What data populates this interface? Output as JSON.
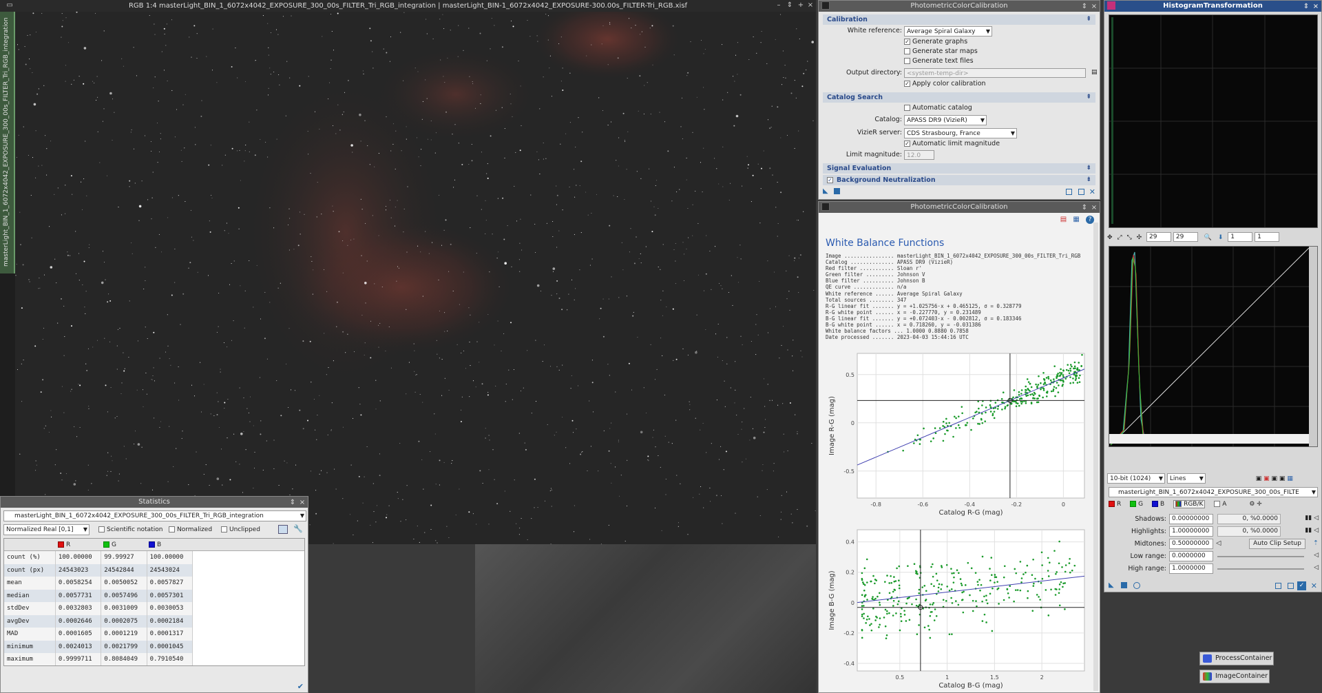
{
  "image_window": {
    "title": "RGB 1:4 masterLight_BIN_1_6072x4042_EXPOSURE_300_00s_FILTER_Tri_RGB_integration | masterLight_BIN-1_6072x4042_EXPOSURE-300.00s_FILTER-Tri_RGB.xisf",
    "vertical_tab": "masterLight_BIN_1_6072x4042_EXPOSURE_300_00s_FILTER_Tri_RGB_integration"
  },
  "statistics": {
    "title": "Statistics",
    "view": "masterLight_BIN_1_6072x4042_EXPOSURE_300_00s_FILTER_Tri_RGB_integration",
    "range": "Normalized Real [0,1]",
    "opts": [
      "Scientific notation",
      "Normalized",
      "Unclipped"
    ],
    "channels": [
      "R",
      "G",
      "B"
    ],
    "channel_colors": [
      "#e01010",
      "#10c010",
      "#1010d0"
    ],
    "rows": [
      [
        "count (%)",
        "100.00000",
        "99.99927",
        "100.00000"
      ],
      [
        "count (px)",
        "24543023",
        "24542844",
        "24543024"
      ],
      [
        "mean",
        "0.0058254",
        "0.0050052",
        "0.0057827"
      ],
      [
        "median",
        "0.0057731",
        "0.0057496",
        "0.0057301"
      ],
      [
        "stdDev",
        "0.0032803",
        "0.0031009",
        "0.0030053"
      ],
      [
        "avgDev",
        "0.0002646",
        "0.0002075",
        "0.0002184"
      ],
      [
        "MAD",
        "0.0001605",
        "0.0001219",
        "0.0001317"
      ],
      [
        "minimum",
        "0.0024013",
        "0.0021799",
        "0.0001045"
      ],
      [
        "maximum",
        "0.9999711",
        "0.8084049",
        "0.7910540"
      ]
    ]
  },
  "pcc1": {
    "title": "PhotometricColorCalibration",
    "sec_calibration": "Calibration",
    "white_ref_label": "White reference:",
    "white_ref_value": "Average Spiral Galaxy",
    "gen_graphs": "Generate graphs",
    "gen_starmaps": "Generate star maps",
    "gen_text": "Generate text files",
    "outdir_label": "Output directory:",
    "outdir_placeholder": "<system-temp-dir>",
    "apply_cc": "Apply color calibration",
    "sec_catalog": "Catalog Search",
    "auto_catalog": "Automatic catalog",
    "catalog_label": "Catalog:",
    "catalog_value": "APASS DR9 (VizieR)",
    "vizier_label": "VizieR server:",
    "vizier_value": "CDS Strasbourg, France",
    "auto_limit": "Automatic limit magnitude",
    "limit_label": "Limit magnitude:",
    "limit_value": "12.0",
    "sec_signal": "Signal Evaluation",
    "sec_bgn": "Background Neutralization"
  },
  "pcc2": {
    "title": "PhotometricColorCalibration",
    "heading": "White Balance Functions",
    "report": "Image ................ masterLight_BIN_1_6072x4042_EXPOSURE_300_00s_FILTER_Tri_RGB\nCatalog .............. APASS DR9 (VizieR)\nRed filter ........... Sloan r'\nGreen filter ......... Johnson V\nBlue filter .......... Johnson B\nQE curve ............. n/a\nWhite reference ...... Average Spiral Galaxy\nTotal sources ........ 347\nR-G linear fit ....... y = +1.025756·x + 0.465125, σ = 0.328779\nR-G white point ...... x = -0.227770, y = 0.231489\nB-G linear fit ....... y = +0.072403·x - 0.002812, σ = 0.183346\nB-G white point ...... x = 0.718260, y = -0.031386\nWhite balance factors ... 1.0000 0.8880 0.7858\nDate processed ....... 2023-04-03 15:44:16 UTC",
    "chart1_xlabel": "Catalog R-G (mag)",
    "chart1_ylabel": "Image R-G (mag)",
    "chart2_xlabel": "Catalog B-G (mag)",
    "chart2_ylabel": "Image B-G (mag)"
  },
  "hist": {
    "title": "HistogramTransformation",
    "zoom_h": "29",
    "zoom_v": "29",
    "zoom_x": "1",
    "zoom_y": "1",
    "bits": "10-bit (1024)",
    "mode": "Lines",
    "view": "masterLight_BIN_1_6072x4042_EXPOSURE_300_00s_FILTE",
    "ch": [
      "R",
      "G",
      "B",
      "RGB/K",
      "A"
    ],
    "shadows_label": "Shadows:",
    "shadows": "0.00000000",
    "shadows_pct": "0, %0.0000",
    "highlights_label": "Highlights:",
    "highlights": "1.00000000",
    "highlights_pct": "0, %0.0000",
    "midtones_label": "Midtones:",
    "midtones": "0.50000000",
    "autoclip": "Auto Clip Setup",
    "lowrange_label": "Low range:",
    "lowrange": "0.0000000",
    "highrange_label": "High range:",
    "highrange": "1.0000000"
  },
  "containers": {
    "process": "ProcessContainer",
    "image": "ImageContainer"
  }
}
